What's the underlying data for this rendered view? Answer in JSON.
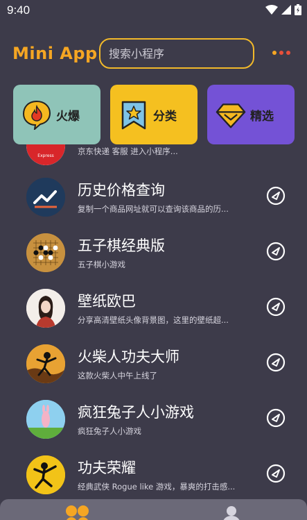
{
  "status_bar": {
    "time": "9:40"
  },
  "header": {
    "logo": "Mini App",
    "search_placeholder": "搜索小程序",
    "dot_colors": [
      "#f5a623",
      "#e8503a",
      "#e8503a"
    ]
  },
  "categories": [
    {
      "label": "火爆",
      "bg": "#8fc4b8",
      "icon": "fire-icon"
    },
    {
      "label": "分类",
      "bg": "#f5c020",
      "icon": "bookmark-star-icon"
    },
    {
      "label": "精选",
      "bg": "#7452d6",
      "icon": "diamond-icon"
    }
  ],
  "list": {
    "items": [
      {
        "title": "",
        "desc": "京东快递 客服 进入小程序...",
        "avatar": "express-avatar"
      },
      {
        "title": "历史价格查询",
        "desc": "复制一个商品网址就可以查询该商品的历...",
        "avatar": "price-chart-avatar"
      },
      {
        "title": "五子棋经典版",
        "desc": "五子棋小游戏",
        "avatar": "gomoku-avatar"
      },
      {
        "title": "壁纸欧巴",
        "desc": "分享高清壁纸头像背景图，这里的壁纸超...",
        "avatar": "wallpaper-avatar"
      },
      {
        "title": "火柴人功夫大师",
        "desc": "这款火柴人中午上线了",
        "avatar": "stickman-avatar"
      },
      {
        "title": "疯狂兔子人小游戏",
        "desc": "疯狂兔子人小游戏",
        "avatar": "rabbit-avatar"
      },
      {
        "title": "功夫荣耀",
        "desc": "经典武侠 Rogue like 游戏，暴爽的打击感...",
        "avatar": "kungfu-avatar"
      }
    ]
  },
  "colors": {
    "background": "#3d3b4a",
    "accent": "#f5a623",
    "search_border": "#f2b92a"
  }
}
